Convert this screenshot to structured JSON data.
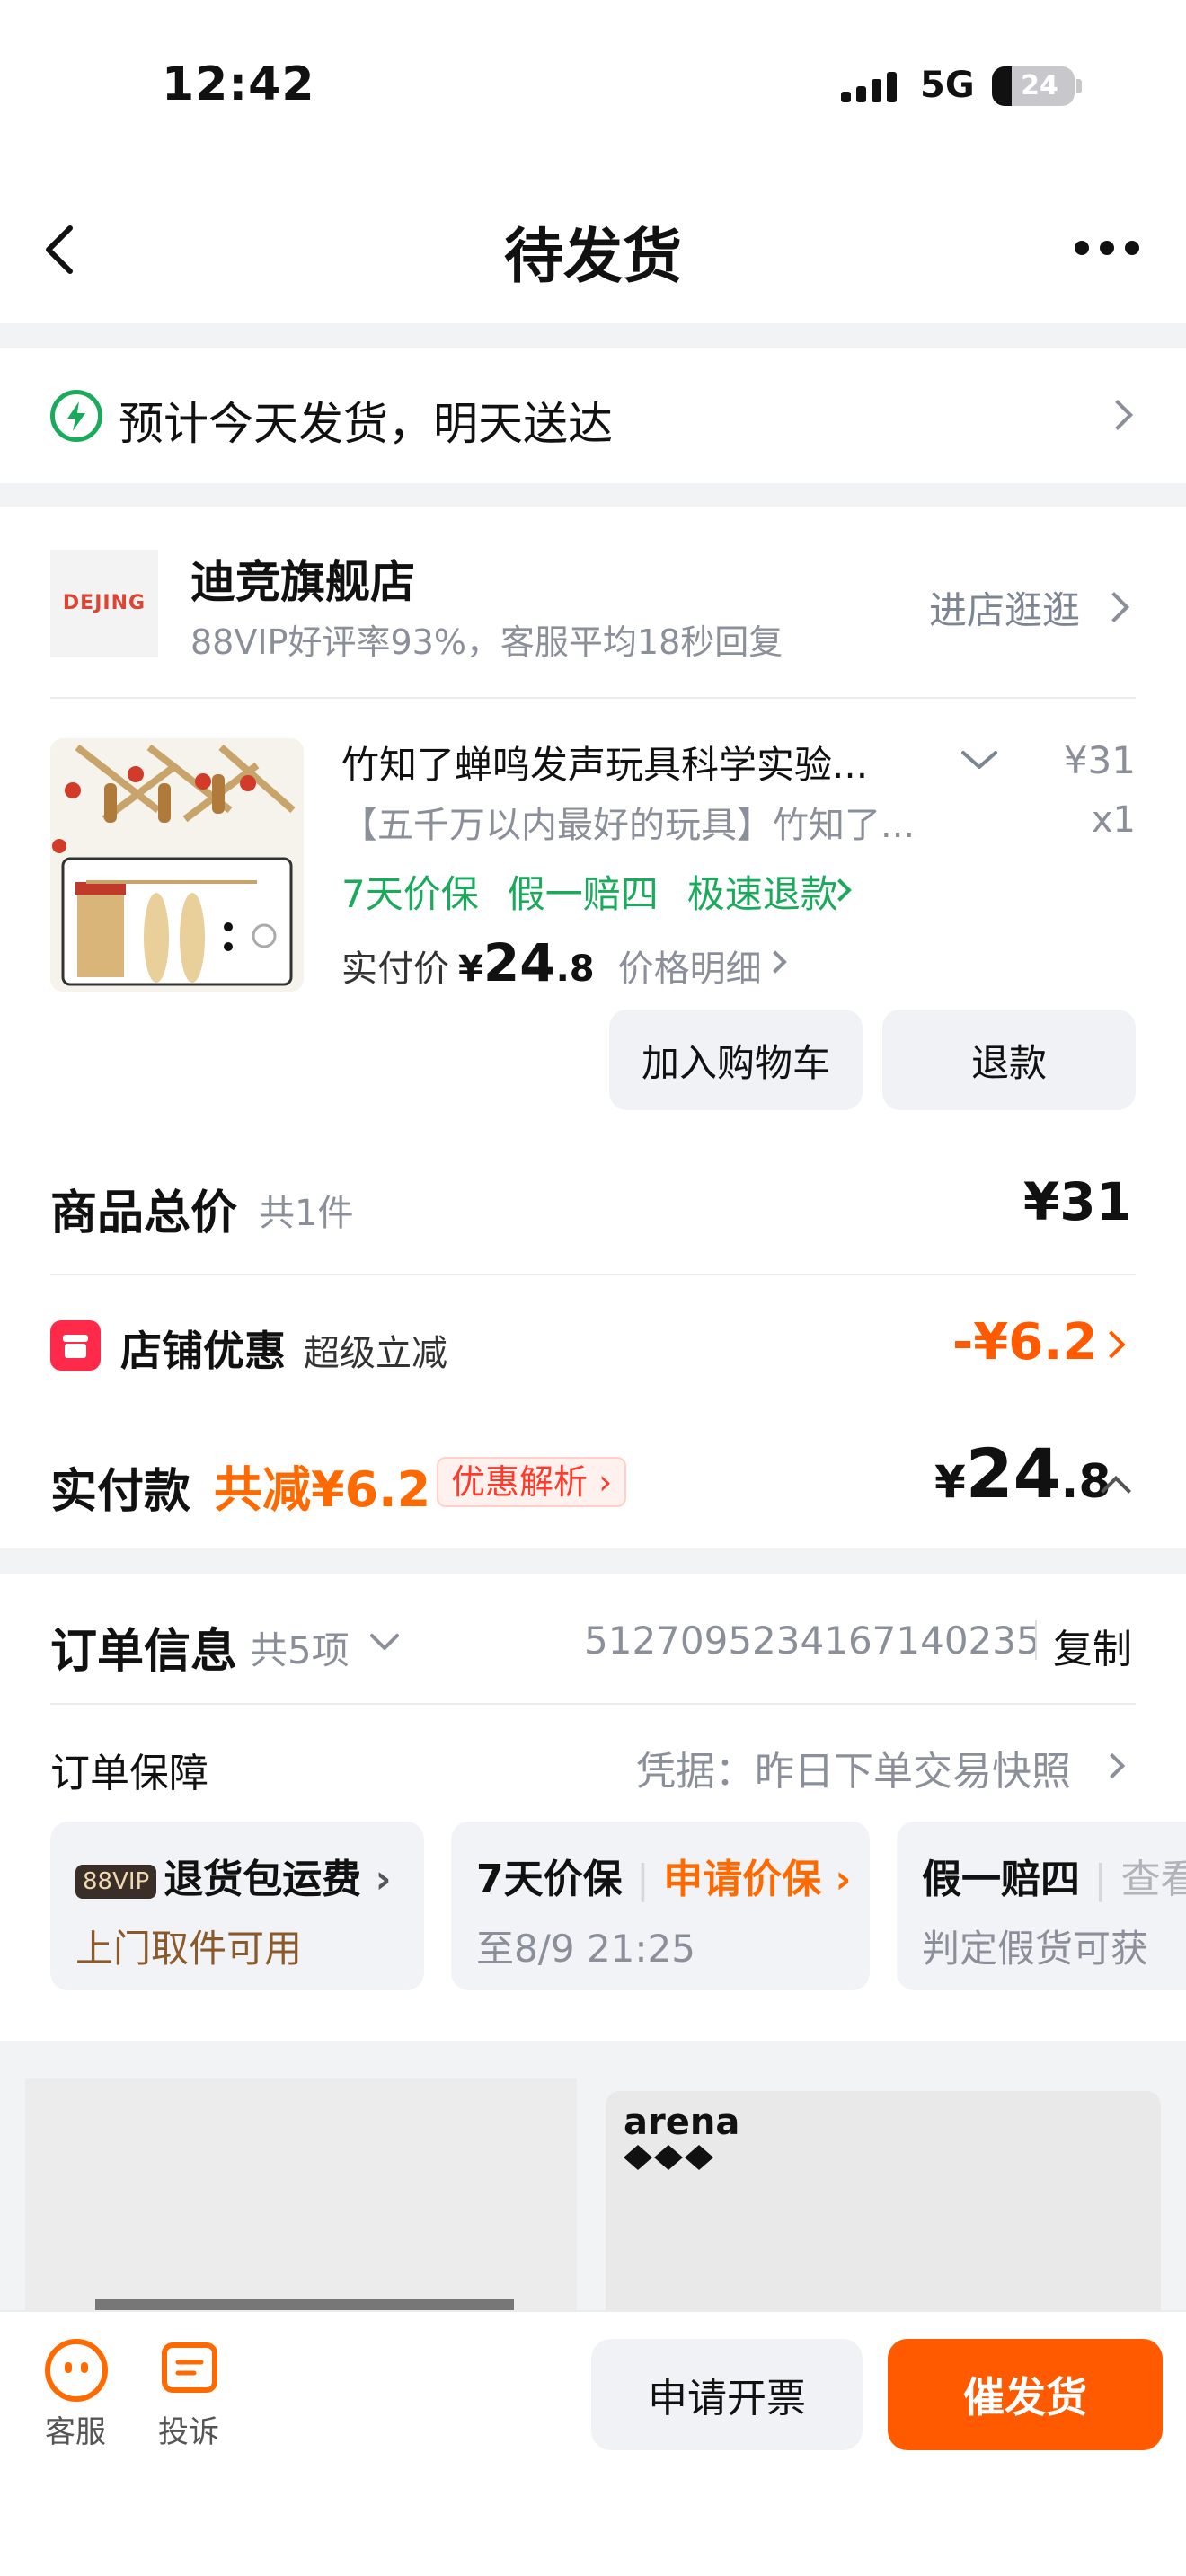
{
  "status_bar": {
    "time": "12:42",
    "network": "5G",
    "battery": "24"
  },
  "nav": {
    "title": "待发货"
  },
  "delivery": {
    "text": "预计今天发货，明天送达"
  },
  "shop": {
    "logo_text": "DEJING",
    "name": "迪竞旗舰店",
    "subtitle": "88VIP好评率93%，客服平均18秒回复",
    "visit_label": "进店逛逛"
  },
  "product": {
    "title": "竹知了蝉鸣发声玩具科学实验...",
    "description": "【五千万以内最好的玩具】竹知了...",
    "price": "¥31",
    "quantity": "x1",
    "tags": [
      "7天价保",
      "假一赔四",
      "极速退款"
    ],
    "paid_label": "实付价",
    "paid_yen": "¥",
    "paid_int": "24",
    "paid_dec": ".8",
    "price_detail": "价格明细",
    "add_cart_label": "加入购物车",
    "refund_label": "退款"
  },
  "summary": {
    "label": "商品总价",
    "count": "共1件",
    "price": "¥31"
  },
  "discount": {
    "label": "店铺优惠",
    "sub": "超级立减",
    "amount": "-¥6.2"
  },
  "payment": {
    "label": "实付款",
    "saved": "共减¥6.2",
    "badge": "优惠解析",
    "total_yen": "¥",
    "total_int": "24",
    "total_dec": ".8"
  },
  "order_info": {
    "label": "订单信息",
    "count": "共5项",
    "number": "5127095234167140235",
    "copy_label": "复制",
    "guarantee_label": "订单保障",
    "guarantee_note": "凭据：昨日下单交易快照",
    "guarantees": [
      {
        "badge": "88VIP",
        "title": "退货包运费",
        "subtitle": "上门取件可用"
      },
      {
        "title": "7天价保",
        "action": "申请价保",
        "subtitle": "至8/9 21:25"
      },
      {
        "title": "假一赔四",
        "action": "查看",
        "subtitle": "判定假货可获"
      }
    ]
  },
  "recommendation": {
    "brand": "arena"
  },
  "bottom_bar": {
    "service_label": "客服",
    "complaint_label": "投诉",
    "invoice_label": "申请开票",
    "urge_label": "催发货"
  },
  "colors": {
    "accent": "#ff5a00",
    "green": "#1aaa5c",
    "discount_red": "#ff2a4a"
  }
}
